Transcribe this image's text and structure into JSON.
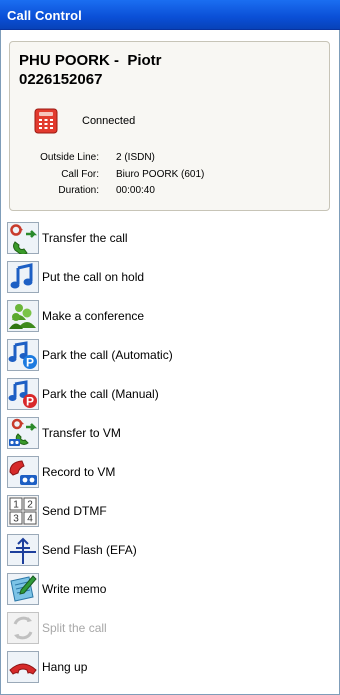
{
  "window": {
    "title": "Call Control"
  },
  "call": {
    "caller_name": "PHU POORK -  Piotr",
    "caller_number": "0226152067",
    "status": "Connected",
    "details": [
      {
        "key": "Outside Line:",
        "value": "2 (ISDN)"
      },
      {
        "key": "Call For:",
        "value": "Biuro POORK (601)"
      },
      {
        "key": "Duration:",
        "value": "00:00:40"
      }
    ]
  },
  "actions": [
    {
      "label": "Transfer the call",
      "icon": "transfer-icon",
      "enabled": true
    },
    {
      "label": "Put the call on hold",
      "icon": "hold-music-icon",
      "enabled": true
    },
    {
      "label": "Make a conference",
      "icon": "conference-icon",
      "enabled": true
    },
    {
      "label": "Park the call (Automatic)",
      "icon": "park-auto-icon",
      "enabled": true
    },
    {
      "label": "Park the call (Manual)",
      "icon": "park-manual-icon",
      "enabled": true
    },
    {
      "label": "Transfer to VM",
      "icon": "transfer-vm-icon",
      "enabled": true
    },
    {
      "label": "Record to VM",
      "icon": "record-vm-icon",
      "enabled": true
    },
    {
      "label": "Send DTMF",
      "icon": "dtmf-keypad-icon",
      "enabled": true
    },
    {
      "label": "Send Flash (EFA)",
      "icon": "flash-icon",
      "enabled": true
    },
    {
      "label": "Write memo",
      "icon": "memo-icon",
      "enabled": true
    },
    {
      "label": "Split the call",
      "icon": "split-icon",
      "enabled": false
    },
    {
      "label": "Hang up",
      "icon": "hang-up-icon",
      "enabled": true
    }
  ],
  "dtmf_keys": [
    "1",
    "2",
    "3",
    "4"
  ]
}
